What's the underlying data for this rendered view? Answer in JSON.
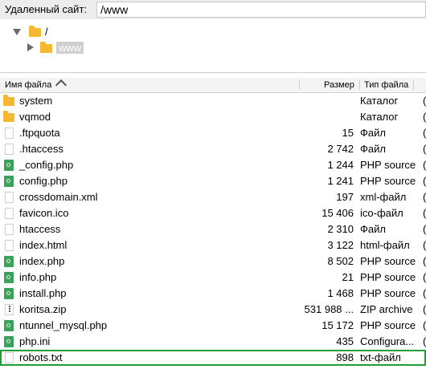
{
  "remote_site": {
    "label": "Удаленный сайт:",
    "path": "/www"
  },
  "tree": {
    "root_label": "/",
    "child_label": "www"
  },
  "columns": {
    "name": "Имя файла",
    "size": "Размер",
    "type": "Тип файла"
  },
  "files": [
    {
      "name": "system",
      "size": "",
      "type": "Каталог",
      "icon": "folder-icon",
      "trail": "("
    },
    {
      "name": "vqmod",
      "size": "",
      "type": "Каталог",
      "icon": "folder-icon",
      "trail": "("
    },
    {
      "name": ".ftpquota",
      "size": "15",
      "type": "Файл",
      "icon": "file-icon",
      "trail": "("
    },
    {
      "name": ".htaccess",
      "size": "2 742",
      "type": "Файл",
      "icon": "file-icon",
      "trail": "("
    },
    {
      "name": "_config.php",
      "size": "1 244",
      "type": "PHP source",
      "icon": "php-file-icon",
      "trail": "("
    },
    {
      "name": "config.php",
      "size": "1 241",
      "type": "PHP source",
      "icon": "php-file-icon",
      "trail": "("
    },
    {
      "name": "crossdomain.xml",
      "size": "197",
      "type": "xml-файл",
      "icon": "file-icon",
      "trail": "("
    },
    {
      "name": "favicon.ico",
      "size": "15 406",
      "type": "ico-файл",
      "icon": "file-icon",
      "trail": "("
    },
    {
      "name": "htaccess",
      "size": "2 310",
      "type": "Файл",
      "icon": "file-icon",
      "trail": "("
    },
    {
      "name": "index.html",
      "size": "3 122",
      "type": "html-файл",
      "icon": "file-icon",
      "trail": "("
    },
    {
      "name": "index.php",
      "size": "8 502",
      "type": "PHP source",
      "icon": "php-file-icon",
      "trail": "("
    },
    {
      "name": "info.php",
      "size": "21",
      "type": "PHP source",
      "icon": "php-file-icon",
      "trail": "("
    },
    {
      "name": "install.php",
      "size": "1 468",
      "type": "PHP source",
      "icon": "php-file-icon",
      "trail": "("
    },
    {
      "name": "koritsa.zip",
      "size": "531 988 ...",
      "type": "ZIP archive",
      "icon": "zip-file-icon",
      "trail": "("
    },
    {
      "name": "ntunnel_mysql.php",
      "size": "15 172",
      "type": "PHP source",
      "icon": "php-file-icon",
      "trail": "("
    },
    {
      "name": "php.ini",
      "size": "435",
      "type": "Configura...",
      "icon": "php-file-icon",
      "trail": "("
    },
    {
      "name": "robots.txt",
      "size": "898",
      "type": "txt-файл",
      "icon": "file-icon",
      "trail": "",
      "highlighted": true
    }
  ],
  "colors": {
    "folder": "#f5b82e",
    "php_icon": "#3aa35a",
    "highlight_outline": "#1e9e35"
  }
}
